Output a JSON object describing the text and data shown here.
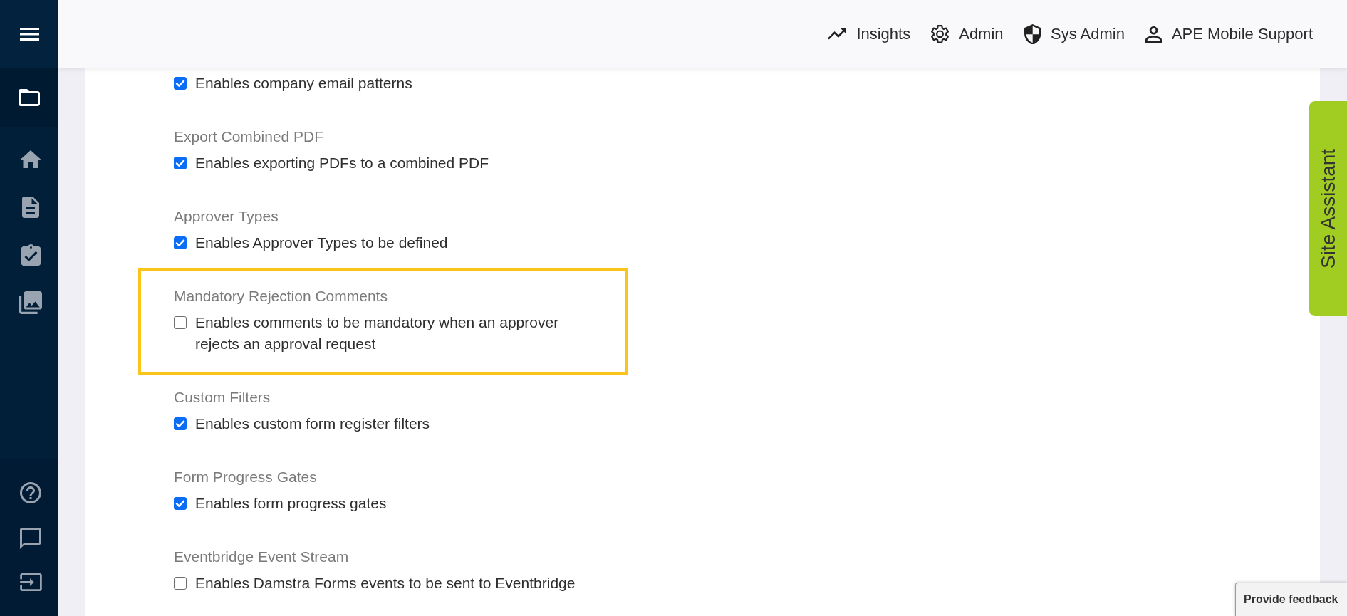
{
  "sidebar": {
    "items": [
      {
        "selected": true
      },
      {
        "selected": false
      },
      {
        "selected": false
      },
      {
        "selected": false
      },
      {
        "selected": false
      }
    ]
  },
  "header": {
    "links": [
      {
        "label": "Insights"
      },
      {
        "label": "Admin"
      },
      {
        "label": "Sys Admin"
      },
      {
        "label": "APE Mobile Support"
      }
    ]
  },
  "settings": [
    {
      "description": "Enables company email patterns",
      "checked": true,
      "highlighted": false
    },
    {
      "title": "Export Combined PDF",
      "description": "Enables exporting PDFs to a combined PDF",
      "checked": true,
      "highlighted": false
    },
    {
      "title": "Approver Types",
      "description": "Enables Approver Types to be defined",
      "checked": true,
      "highlighted": false
    },
    {
      "title": "Mandatory Rejection Comments",
      "description": "Enables comments to be mandatory when an approver rejects an approval request",
      "checked": false,
      "highlighted": true
    },
    {
      "title": "Custom Filters",
      "description": "Enables custom form register filters",
      "checked": true,
      "highlighted": false
    },
    {
      "title": "Form Progress Gates",
      "description": "Enables form progress gates",
      "checked": true,
      "highlighted": false
    },
    {
      "title": "Eventbridge Event Stream",
      "description": "Enables Damstra Forms events to be sent to Eventbridge",
      "checked": false,
      "highlighted": false
    }
  ],
  "site_assistant": {
    "label": "Site Assistant"
  },
  "feedback_button": {
    "label": "Provide feedback"
  }
}
